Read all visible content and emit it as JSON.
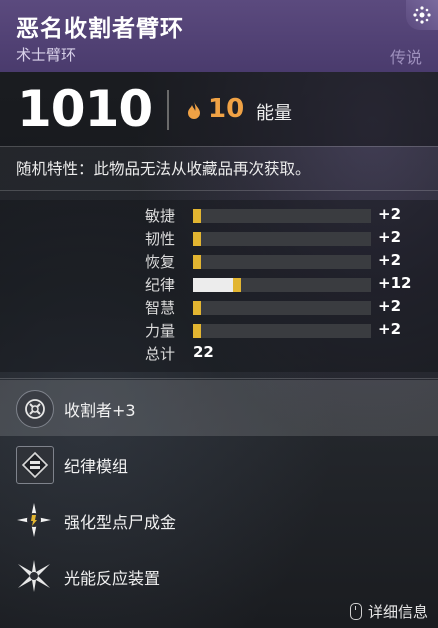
{
  "item": {
    "name": "恶名收割者臂环",
    "type": "术士臂环",
    "rarity": "传说"
  },
  "power": {
    "value": "1010",
    "energy_value": "10",
    "energy_label": "能量",
    "energy_color": "#f0a245"
  },
  "random_perk_note": "随机特性：此物品无法从收藏品再次获取。",
  "stats": [
    {
      "label": "敏捷",
      "value": "+2",
      "base": 0,
      "mod": 2
    },
    {
      "label": "韧性",
      "value": "+2",
      "base": 0,
      "mod": 2
    },
    {
      "label": "恢复",
      "value": "+2",
      "base": 0,
      "mod": 2
    },
    {
      "label": "纪律",
      "value": "+12",
      "base": 10,
      "mod": 2
    },
    {
      "label": "智慧",
      "value": "+2",
      "base": 0,
      "mod": 2
    },
    {
      "label": "力量",
      "value": "+2",
      "base": 0,
      "mod": 2
    }
  ],
  "stat_max": 45,
  "total": {
    "label": "总计",
    "value": "22"
  },
  "perks": [
    {
      "label": "收割者+3",
      "icon": "reaper-icon"
    },
    {
      "label": "纪律模组",
      "icon": "discipline-mod-icon"
    },
    {
      "label": "强化型点尸成金",
      "icon": "charged-with-light-icon"
    },
    {
      "label": "光能反应装置",
      "icon": "spark-icon"
    }
  ],
  "details_label": "详细信息",
  "colors": {
    "header": "#5b4a7e",
    "stat_mod": "#e2b531",
    "stat_base": "#ececec"
  }
}
